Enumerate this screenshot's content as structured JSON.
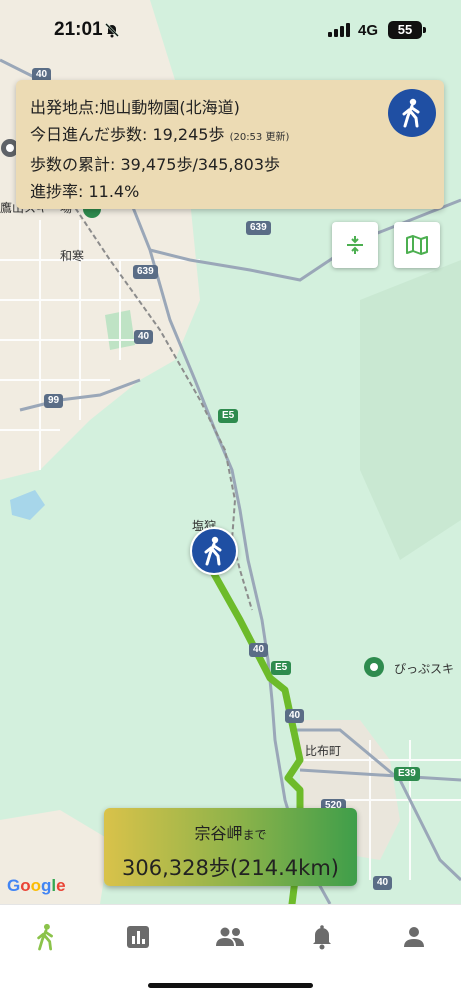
{
  "status_bar": {
    "time": "21:01",
    "network": "4G",
    "battery": "55"
  },
  "progress_card": {
    "start_point": "出発地点:旭山動物園(北海道)",
    "today_steps_label": "今日進んだ歩数: 19,245歩",
    "today_updated": "(20:53 更新)",
    "total_steps": "歩数の累計: 39,475歩/345,803歩",
    "progress_rate": "進捗率: 11.4%",
    "progress_fraction": 0.114
  },
  "map_controls": {
    "compress_icon": "compress-vertical-icon",
    "map_icon": "map-icon"
  },
  "map_labels": {
    "wassamu": "和寒",
    "shiokari": "塩狩",
    "pippu": "ぴっぷスキ",
    "biei_town": "比布町",
    "partial_top_left": "鷹山スキー場"
  },
  "road_shields": {
    "r40_a": "40",
    "r40_b": "40",
    "r40_c": "40",
    "r40_d": "40",
    "r40_e": "40",
    "r639_a": "639",
    "r639_b": "639",
    "r99": "99",
    "e5_a": "E5",
    "e5_b": "E5",
    "e39": "E39",
    "r520": "520"
  },
  "goal_card": {
    "destination": "宗谷岬",
    "suffix": "まで",
    "remaining": "306,328歩(214.4km)"
  },
  "attribution": {
    "google": [
      "G",
      "o",
      "o",
      "g",
      "l",
      "e"
    ],
    "colors": [
      "#4285F4",
      "#EA4335",
      "#FBBC05",
      "#4285F4",
      "#34A853",
      "#EA4335"
    ]
  },
  "tab_bar": {
    "tabs": [
      "walk-icon",
      "chart-icon",
      "people-icon",
      "bell-icon",
      "person-icon"
    ],
    "active_color": "#8bc34a",
    "inactive_color": "#6b6b6b"
  }
}
